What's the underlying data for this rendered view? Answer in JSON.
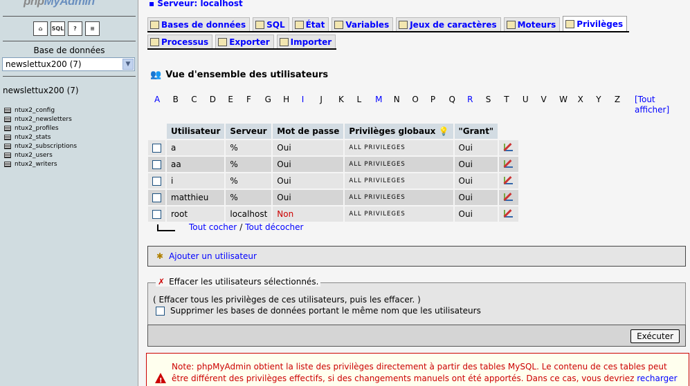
{
  "nav": {
    "logo_php": "php",
    "logo_my": "MyAdmin",
    "icons": [
      "home-icon",
      "sql-icon",
      "help-icon",
      "docs-icon"
    ],
    "db_label": "Base de données",
    "db_selected": "newslettux200 (7)",
    "db_name": "newslettux200 (7)",
    "tables": [
      "ntux2_config",
      "ntux2_newsletters",
      "ntux2_profiles",
      "ntux2_stats",
      "ntux2_subscriptions",
      "ntux2_users",
      "ntux2_writers"
    ]
  },
  "header": {
    "server_label": "Serveur:",
    "server_name": "localhost"
  },
  "tabs": {
    "row1": [
      "Bases de données",
      "SQL",
      "État",
      "Variables",
      "Jeux de caractères",
      "Moteurs",
      "Privilèges"
    ],
    "row2": [
      "Processus",
      "Exporter",
      "Importer"
    ],
    "active": "Privilèges"
  },
  "main": {
    "title": "Vue d'ensemble des utilisateurs",
    "letters": [
      "A",
      "B",
      "C",
      "D",
      "E",
      "F",
      "G",
      "H",
      "I",
      "J",
      "K",
      "L",
      "M",
      "N",
      "O",
      "P",
      "Q",
      "R",
      "S",
      "T",
      "U",
      "V",
      "W",
      "X",
      "Y",
      "Z"
    ],
    "linked_letters": [
      "A",
      "I",
      "M",
      "R"
    ],
    "show_all_1": "[Tout",
    "show_all_2": "afficher]",
    "columns": [
      "Utilisateur",
      "Serveur",
      "Mot de passe",
      "Privilèges globaux",
      "\"Grant\""
    ],
    "rows": [
      {
        "user": "a",
        "host": "%",
        "password": "Oui",
        "privileges": "ALL PRIVILEGES",
        "grant": "Oui"
      },
      {
        "user": "aa",
        "host": "%",
        "password": "Oui",
        "privileges": "ALL PRIVILEGES",
        "grant": "Oui"
      },
      {
        "user": "i",
        "host": "%",
        "password": "Oui",
        "privileges": "ALL PRIVILEGES",
        "grant": "Oui"
      },
      {
        "user": "matthieu",
        "host": "%",
        "password": "Oui",
        "privileges": "ALL PRIVILEGES",
        "grant": "Oui"
      },
      {
        "user": "root",
        "host": "localhost",
        "password": "Non",
        "privileges": "ALL PRIVILEGES",
        "grant": "Oui"
      }
    ],
    "check_all": "Tout cocher",
    "separator": "/",
    "uncheck_all": "Tout décocher",
    "add_user": "Ajouter un utilisateur",
    "delete_legend": "Effacer les utilisateurs sélectionnés.",
    "delete_info": "( Effacer tous les privilèges de ces utilisateurs, puis les effacer. )",
    "delete_db_label": "Supprimer les bases de données portant le même nom que les utilisateurs",
    "execute": "Exécuter",
    "note_text": "Note: phpMyAdmin obtient la liste des privilèges directement à partir des tables MySQL. Le contenu de ces tables peut être différent des privilèges effectifs, si des changements manuels ont été apportés. Dans ce cas, vous devriez ",
    "note_link": "recharger les"
  }
}
